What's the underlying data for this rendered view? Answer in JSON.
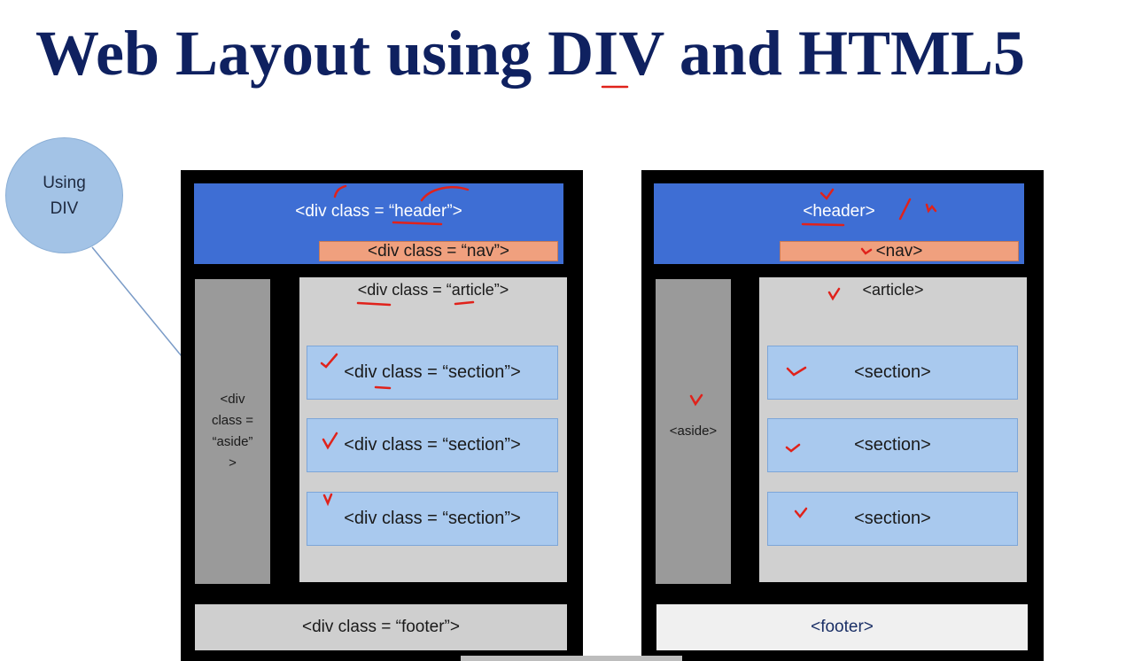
{
  "slide": {
    "title": "Web Layout using DIV and HTML5",
    "bubble_label": "Using\nDIV"
  },
  "div_layout": {
    "header": "<div class = “header”>",
    "nav": "<div class = “nav”>",
    "article": "<div class = “article”>",
    "aside": "<div\nclass =\n“aside”\n>",
    "sections": [
      "<div class = “section”>",
      "<div class = “section”>",
      "<div class = “section”>"
    ],
    "footer": "<div class = “footer”>"
  },
  "html5_layout": {
    "header": "<header>",
    "nav": "<nav>",
    "article": "<article>",
    "aside": "<aside>",
    "sections": [
      "<section>",
      "<section>",
      "<section>"
    ],
    "footer": "<footer>"
  },
  "colors": {
    "title": "#0f2160",
    "header_fill": "#3e6ed4",
    "nav_fill": "#f0a07e",
    "section_fill": "#a9c9ee",
    "annotation": "#e0221b"
  }
}
